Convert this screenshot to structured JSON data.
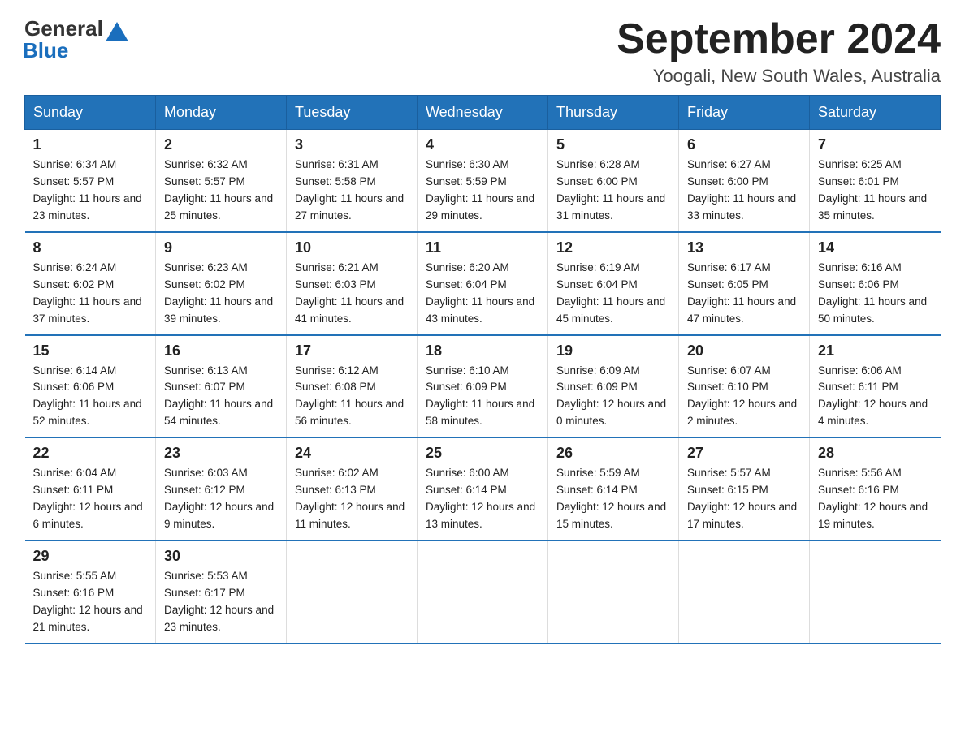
{
  "header": {
    "logo_general": "General",
    "logo_blue": "Blue",
    "month_title": "September 2024",
    "location": "Yoogali, New South Wales, Australia"
  },
  "weekdays": [
    "Sunday",
    "Monday",
    "Tuesday",
    "Wednesday",
    "Thursday",
    "Friday",
    "Saturday"
  ],
  "weeks": [
    [
      {
        "day": "1",
        "sunrise": "Sunrise: 6:34 AM",
        "sunset": "Sunset: 5:57 PM",
        "daylight": "Daylight: 11 hours and 23 minutes."
      },
      {
        "day": "2",
        "sunrise": "Sunrise: 6:32 AM",
        "sunset": "Sunset: 5:57 PM",
        "daylight": "Daylight: 11 hours and 25 minutes."
      },
      {
        "day": "3",
        "sunrise": "Sunrise: 6:31 AM",
        "sunset": "Sunset: 5:58 PM",
        "daylight": "Daylight: 11 hours and 27 minutes."
      },
      {
        "day": "4",
        "sunrise": "Sunrise: 6:30 AM",
        "sunset": "Sunset: 5:59 PM",
        "daylight": "Daylight: 11 hours and 29 minutes."
      },
      {
        "day": "5",
        "sunrise": "Sunrise: 6:28 AM",
        "sunset": "Sunset: 6:00 PM",
        "daylight": "Daylight: 11 hours and 31 minutes."
      },
      {
        "day": "6",
        "sunrise": "Sunrise: 6:27 AM",
        "sunset": "Sunset: 6:00 PM",
        "daylight": "Daylight: 11 hours and 33 minutes."
      },
      {
        "day": "7",
        "sunrise": "Sunrise: 6:25 AM",
        "sunset": "Sunset: 6:01 PM",
        "daylight": "Daylight: 11 hours and 35 minutes."
      }
    ],
    [
      {
        "day": "8",
        "sunrise": "Sunrise: 6:24 AM",
        "sunset": "Sunset: 6:02 PM",
        "daylight": "Daylight: 11 hours and 37 minutes."
      },
      {
        "day": "9",
        "sunrise": "Sunrise: 6:23 AM",
        "sunset": "Sunset: 6:02 PM",
        "daylight": "Daylight: 11 hours and 39 minutes."
      },
      {
        "day": "10",
        "sunrise": "Sunrise: 6:21 AM",
        "sunset": "Sunset: 6:03 PM",
        "daylight": "Daylight: 11 hours and 41 minutes."
      },
      {
        "day": "11",
        "sunrise": "Sunrise: 6:20 AM",
        "sunset": "Sunset: 6:04 PM",
        "daylight": "Daylight: 11 hours and 43 minutes."
      },
      {
        "day": "12",
        "sunrise": "Sunrise: 6:19 AM",
        "sunset": "Sunset: 6:04 PM",
        "daylight": "Daylight: 11 hours and 45 minutes."
      },
      {
        "day": "13",
        "sunrise": "Sunrise: 6:17 AM",
        "sunset": "Sunset: 6:05 PM",
        "daylight": "Daylight: 11 hours and 47 minutes."
      },
      {
        "day": "14",
        "sunrise": "Sunrise: 6:16 AM",
        "sunset": "Sunset: 6:06 PM",
        "daylight": "Daylight: 11 hours and 50 minutes."
      }
    ],
    [
      {
        "day": "15",
        "sunrise": "Sunrise: 6:14 AM",
        "sunset": "Sunset: 6:06 PM",
        "daylight": "Daylight: 11 hours and 52 minutes."
      },
      {
        "day": "16",
        "sunrise": "Sunrise: 6:13 AM",
        "sunset": "Sunset: 6:07 PM",
        "daylight": "Daylight: 11 hours and 54 minutes."
      },
      {
        "day": "17",
        "sunrise": "Sunrise: 6:12 AM",
        "sunset": "Sunset: 6:08 PM",
        "daylight": "Daylight: 11 hours and 56 minutes."
      },
      {
        "day": "18",
        "sunrise": "Sunrise: 6:10 AM",
        "sunset": "Sunset: 6:09 PM",
        "daylight": "Daylight: 11 hours and 58 minutes."
      },
      {
        "day": "19",
        "sunrise": "Sunrise: 6:09 AM",
        "sunset": "Sunset: 6:09 PM",
        "daylight": "Daylight: 12 hours and 0 minutes."
      },
      {
        "day": "20",
        "sunrise": "Sunrise: 6:07 AM",
        "sunset": "Sunset: 6:10 PM",
        "daylight": "Daylight: 12 hours and 2 minutes."
      },
      {
        "day": "21",
        "sunrise": "Sunrise: 6:06 AM",
        "sunset": "Sunset: 6:11 PM",
        "daylight": "Daylight: 12 hours and 4 minutes."
      }
    ],
    [
      {
        "day": "22",
        "sunrise": "Sunrise: 6:04 AM",
        "sunset": "Sunset: 6:11 PM",
        "daylight": "Daylight: 12 hours and 6 minutes."
      },
      {
        "day": "23",
        "sunrise": "Sunrise: 6:03 AM",
        "sunset": "Sunset: 6:12 PM",
        "daylight": "Daylight: 12 hours and 9 minutes."
      },
      {
        "day": "24",
        "sunrise": "Sunrise: 6:02 AM",
        "sunset": "Sunset: 6:13 PM",
        "daylight": "Daylight: 12 hours and 11 minutes."
      },
      {
        "day": "25",
        "sunrise": "Sunrise: 6:00 AM",
        "sunset": "Sunset: 6:14 PM",
        "daylight": "Daylight: 12 hours and 13 minutes."
      },
      {
        "day": "26",
        "sunrise": "Sunrise: 5:59 AM",
        "sunset": "Sunset: 6:14 PM",
        "daylight": "Daylight: 12 hours and 15 minutes."
      },
      {
        "day": "27",
        "sunrise": "Sunrise: 5:57 AM",
        "sunset": "Sunset: 6:15 PM",
        "daylight": "Daylight: 12 hours and 17 minutes."
      },
      {
        "day": "28",
        "sunrise": "Sunrise: 5:56 AM",
        "sunset": "Sunset: 6:16 PM",
        "daylight": "Daylight: 12 hours and 19 minutes."
      }
    ],
    [
      {
        "day": "29",
        "sunrise": "Sunrise: 5:55 AM",
        "sunset": "Sunset: 6:16 PM",
        "daylight": "Daylight: 12 hours and 21 minutes."
      },
      {
        "day": "30",
        "sunrise": "Sunrise: 5:53 AM",
        "sunset": "Sunset: 6:17 PM",
        "daylight": "Daylight: 12 hours and 23 minutes."
      },
      {
        "day": "",
        "sunrise": "",
        "sunset": "",
        "daylight": ""
      },
      {
        "day": "",
        "sunrise": "",
        "sunset": "",
        "daylight": ""
      },
      {
        "day": "",
        "sunrise": "",
        "sunset": "",
        "daylight": ""
      },
      {
        "day": "",
        "sunrise": "",
        "sunset": "",
        "daylight": ""
      },
      {
        "day": "",
        "sunrise": "",
        "sunset": "",
        "daylight": ""
      }
    ]
  ]
}
